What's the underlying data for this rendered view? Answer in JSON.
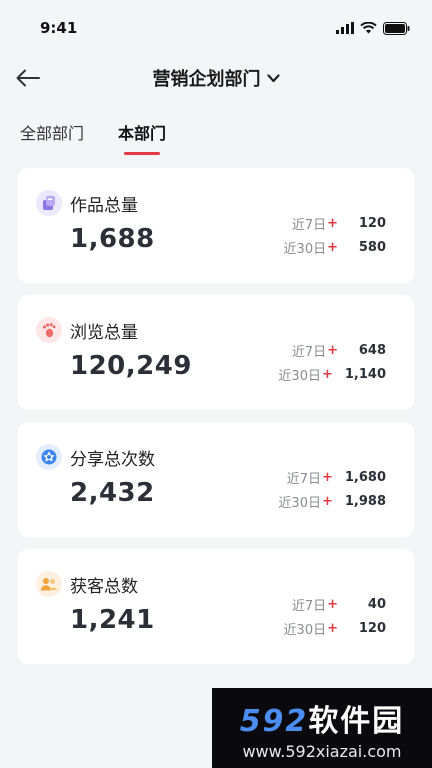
{
  "status": {
    "time": "9:41"
  },
  "nav": {
    "title": "营销企划部门"
  },
  "tabs": [
    {
      "label": "全部部门",
      "active": false
    },
    {
      "label": "本部门",
      "active": true
    }
  ],
  "colors": {
    "accent": "#e23a44",
    "text_dark": "#2d2f38",
    "muted": "#8a8c93"
  },
  "cards": [
    {
      "icon": "works-icon",
      "title": "作品总量",
      "total": "1,688",
      "stats": [
        {
          "label": "近7日",
          "value": "120"
        },
        {
          "label": "近30日",
          "value": "580"
        }
      ]
    },
    {
      "icon": "footprint-icon",
      "title": "浏览总量",
      "total": "120,249",
      "stats": [
        {
          "label": "近7日",
          "value": "648"
        },
        {
          "label": "近30日",
          "value": "1,140"
        }
      ]
    },
    {
      "icon": "share-icon",
      "title": "分享总次数",
      "total": "2,432",
      "stats": [
        {
          "label": "近7日",
          "value": "1,680"
        },
        {
          "label": "近30日",
          "value": "1,988"
        }
      ]
    },
    {
      "icon": "customers-icon",
      "title": "获客总数",
      "total": "1,241",
      "stats": [
        {
          "label": "近7日",
          "value": "40"
        },
        {
          "label": "近30日",
          "value": "120"
        }
      ]
    }
  ],
  "plus_sign": "+",
  "watermark": {
    "brand_num": "592",
    "brand_cn": "软件园",
    "url": "www.592xiazai.com"
  }
}
